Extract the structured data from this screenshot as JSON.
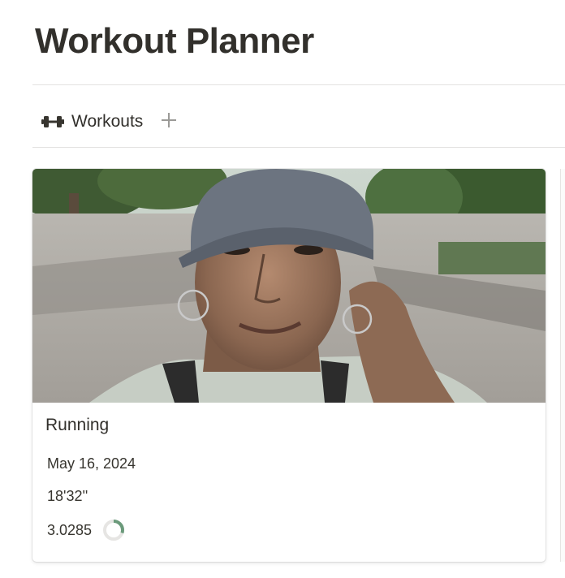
{
  "page": {
    "title": "Workout Planner"
  },
  "views": {
    "tabs": [
      {
        "label": "Workouts",
        "icon": "dumbbell-icon"
      }
    ],
    "add_icon": "plus-icon"
  },
  "cards": [
    {
      "title": "Running",
      "cover": "selfie photo of a woman in a grey cap on a tree-lined path",
      "date": "May 16, 2024",
      "duration": "18'32''",
      "distance": "3.0285",
      "progress": 0.3,
      "progress_color": "#6b9a7b"
    }
  ],
  "colors": {
    "text": "#37352f",
    "divider": "#e3e2e0",
    "accent": "#6b9a7b"
  }
}
